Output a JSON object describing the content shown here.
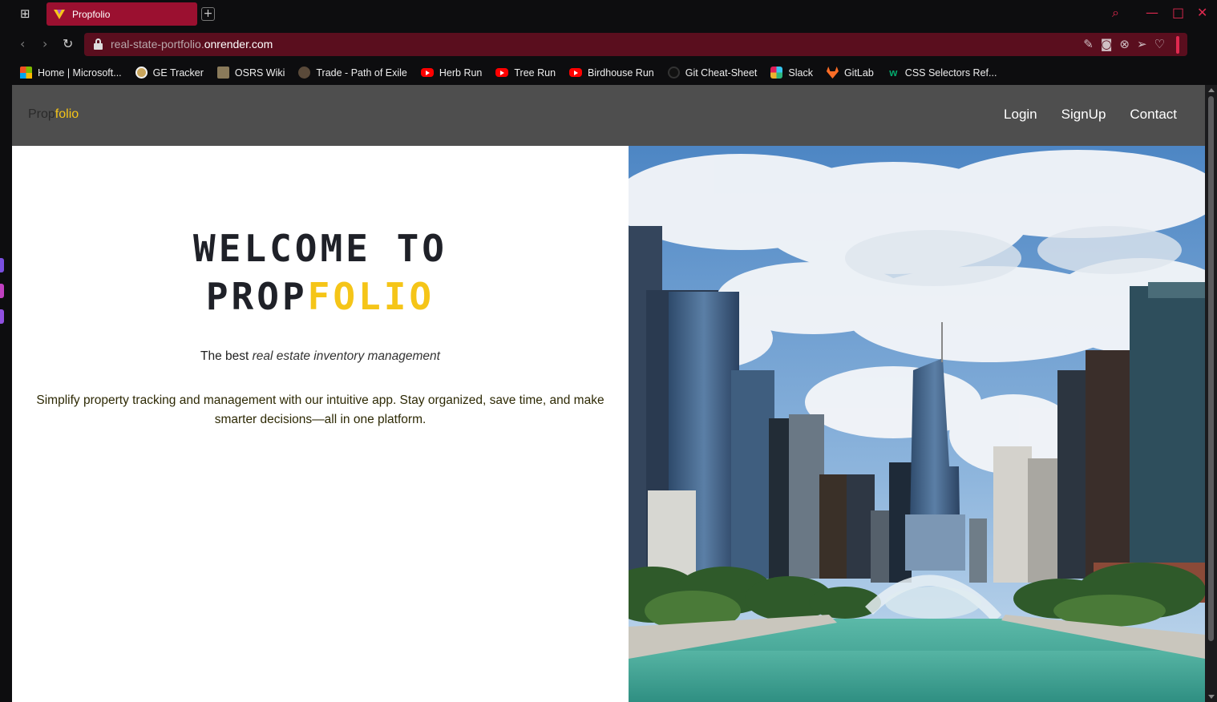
{
  "browser": {
    "tab_title": "Propfolio",
    "new_tab_label": "+",
    "url_prefix": "real-state-portfolio.",
    "url_domain": "onrender.com",
    "bookmarks": [
      {
        "label": "Home | Microsoft...",
        "icon": "microsoft-icon"
      },
      {
        "label": "GE Tracker",
        "icon": "ge-tracker-icon"
      },
      {
        "label": "OSRS Wiki",
        "icon": "osrs-wiki-icon"
      },
      {
        "label": "Trade - Path of Exile",
        "icon": "path-of-exile-icon"
      },
      {
        "label": "Herb Run",
        "icon": "youtube-icon"
      },
      {
        "label": "Tree Run",
        "icon": "youtube-icon"
      },
      {
        "label": "Birdhouse Run",
        "icon": "youtube-icon"
      },
      {
        "label": "Git Cheat-Sheet",
        "icon": "github-icon"
      },
      {
        "label": "Slack",
        "icon": "slack-icon"
      },
      {
        "label": "GitLab",
        "icon": "gitlab-icon"
      },
      {
        "label": "CSS Selectors Ref...",
        "icon": "w3schools-icon"
      }
    ],
    "accent_color": "#e0294f"
  },
  "site": {
    "brand_part1": "Prop",
    "brand_part2": "folio",
    "nav": {
      "login": "Login",
      "signup": "SignUp",
      "contact": "Contact"
    },
    "hero": {
      "title_line1": "WELCOME TO",
      "title_line2_a": "PROP",
      "title_line2_b": "FOLIO",
      "subtitle_a": "The best ",
      "subtitle_b": "real estate inventory management",
      "description": "Simplify property tracking and management with our intuitive app. Stay organized, save time, and make smarter decisions—all in one platform."
    },
    "brand_color": "#f5c518"
  }
}
